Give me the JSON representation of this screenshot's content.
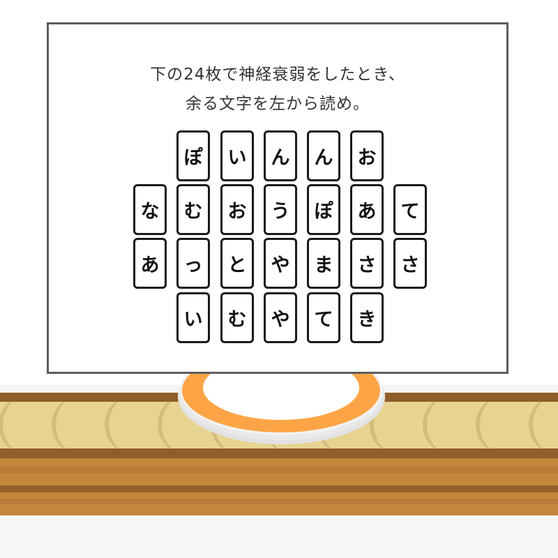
{
  "puzzle": {
    "line1": "下の24枚で神経衰弱をしたとき、",
    "line2": "余る文字を左から読め。",
    "rows": [
      {
        "offset": 1,
        "cards": [
          "ぽ",
          "い",
          "ん",
          "ん",
          "お"
        ]
      },
      {
        "offset": 0,
        "cards": [
          "な",
          "む",
          "お",
          "う",
          "ぽ",
          "あ",
          "て"
        ]
      },
      {
        "offset": 0,
        "cards": [
          "あ",
          "っ",
          "と",
          "や",
          "ま",
          "さ",
          "さ"
        ]
      },
      {
        "offset": 1,
        "cards": [
          "い",
          "む",
          "や",
          "て",
          "き"
        ]
      }
    ]
  },
  "colors": {
    "plate_rim": "#fda546",
    "board_border": "#5d5d5d"
  }
}
